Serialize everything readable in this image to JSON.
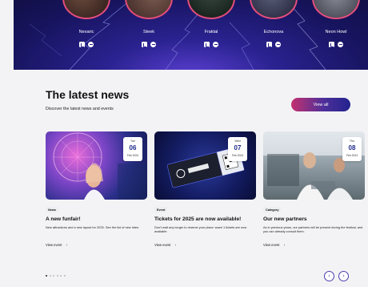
{
  "artists": [
    {
      "name": "Nexaric"
    },
    {
      "name": "Steek"
    },
    {
      "name": "Fraktal"
    },
    {
      "name": "Echonova"
    },
    {
      "name": "Neon Howl"
    }
  ],
  "news": {
    "title": "The latest news",
    "subtitle": "Discover the latest news and events",
    "view_all": "View all",
    "cards": [
      {
        "date": {
          "dow": "Tue",
          "day": "06",
          "month_year": "Feb 2024"
        },
        "tag": "News",
        "title": "A new funfair!",
        "description": "New attractions and a new layout for 2025. See the list of new rides.",
        "more": "View event"
      },
      {
        "date": {
          "dow": "Wed",
          "day": "07",
          "month_year": "Feb 2024"
        },
        "tag": "Event",
        "title": "Tickets for 2025 are now available!",
        "description": "Don't wait any longer to reserve your place: wave 1 tickets are now available.",
        "more": "View event"
      },
      {
        "date": {
          "dow": "Thu",
          "day": "08",
          "month_year": "Feb 2024"
        },
        "tag": "Category",
        "title": "Our new partners",
        "description": "As in previous years, our partners will be present during the festival, and you can already consult them.",
        "more": "View event"
      }
    ]
  },
  "pager": {
    "active_index": 0,
    "count": 6
  },
  "colors": {
    "accent": "#4a3fb0",
    "button_start": "#c4306f",
    "button_end": "#23238d",
    "date_day": "#1e2a8a"
  },
  "icons": {
    "arrow_left": "arrow-left-icon",
    "arrow_right": "arrow-right-icon",
    "music": "music-app-icon",
    "spotify": "spotify-icon",
    "chevron": "chevron-right-icon"
  }
}
